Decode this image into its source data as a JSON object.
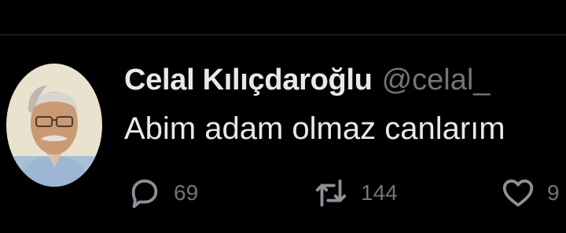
{
  "tweet": {
    "author": {
      "display_name": "Celal Kılıçdaroğlu",
      "handle": "@celal_",
      "avatar": "avatar-photo"
    },
    "text": "Abim adam olmaz canlarım",
    "actions": {
      "reply": {
        "icon": "reply-icon",
        "count": "69"
      },
      "retweet": {
        "icon": "retweet-icon",
        "count": "144"
      },
      "like": {
        "icon": "heart-icon",
        "count": "9"
      }
    }
  },
  "colors": {
    "background": "#000000",
    "primary_text": "#e7e9ea",
    "secondary_text": "#71767b",
    "divider": "#2f3336"
  }
}
